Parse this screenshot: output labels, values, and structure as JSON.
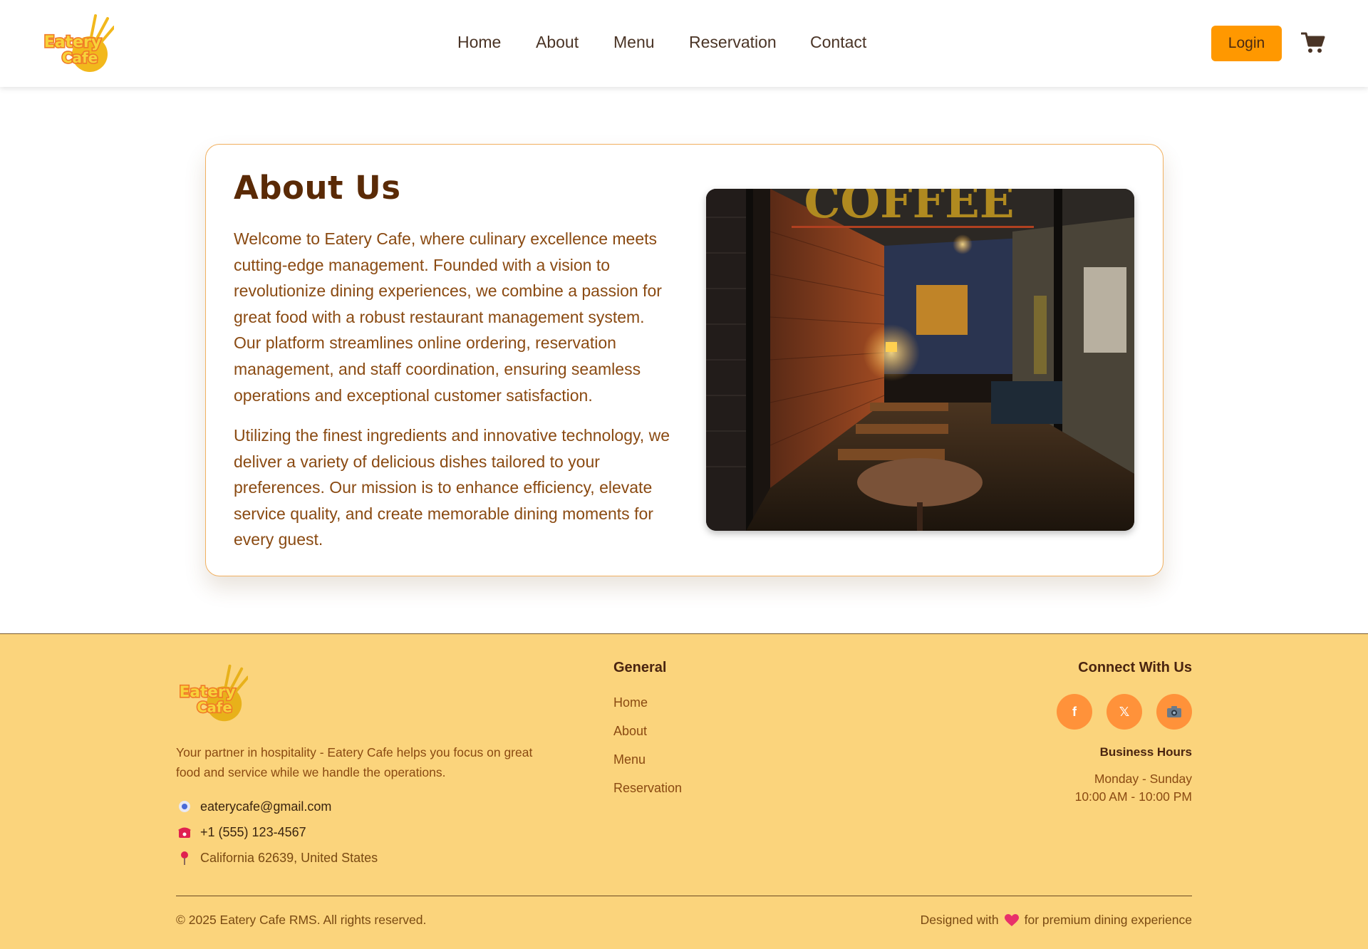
{
  "brand": {
    "logo_line1": "Eatery",
    "logo_line2": "Cafe"
  },
  "nav": {
    "items": [
      {
        "label": "Home"
      },
      {
        "label": "About"
      },
      {
        "label": "Menu"
      },
      {
        "label": "Reservation"
      },
      {
        "label": "Contact"
      }
    ],
    "login_label": "Login",
    "cart_icon": "cart-icon"
  },
  "about": {
    "title": "About Us",
    "paragraphs": [
      "Welcome to Eatery Cafe, where culinary excellence meets cutting-edge management. Founded with a vision to revolutionize dining experiences, we combine a passion for great food with a robust restaurant management system. Our platform streamlines online ordering, reservation management, and staff coordination, ensuring seamless operations and exceptional customer satisfaction.",
      "Utilizing the finest ingredients and innovative technology, we deliver a variety of delicious dishes tailored to your preferences. Our mission is to enhance efficiency, elevate service quality, and create memorable dining moments for every guest."
    ],
    "photo_sign_text": "COFFEE"
  },
  "footer": {
    "description": "Your partner in hospitality - Eatery Cafe helps you focus on great food and service while we handle the operations.",
    "contacts": [
      {
        "icon": "email-icon",
        "text": "eaterycafe@gmail.com"
      },
      {
        "icon": "phone-icon",
        "text": "+1 (555) 123-4567"
      },
      {
        "icon": "location-pin-icon",
        "text": "California 62639, United States"
      }
    ],
    "general_title": "General",
    "general_links": [
      {
        "label": "Home"
      },
      {
        "label": "About"
      },
      {
        "label": "Menu"
      },
      {
        "label": "Reservation"
      }
    ],
    "connect_title": "Connect With Us",
    "social": [
      {
        "icon": "facebook-icon",
        "glyph": "f"
      },
      {
        "icon": "x-icon",
        "glyph": "𝕏"
      },
      {
        "icon": "camera-icon",
        "glyph": ""
      }
    ],
    "hours_title": "Business Hours",
    "hours_days": "Monday - Sunday",
    "hours_time": "10:00 AM - 10:00 PM",
    "copyright": "© 2025 Eatery Cafe RMS. All rights reserved.",
    "designed_prefix": "Designed with",
    "designed_suffix": "for premium dining experience"
  },
  "colors": {
    "accent": "#ff9800",
    "footer_bg": "#fbd47c",
    "title_brown": "#5a2a06",
    "text_brown": "#8a4a12",
    "social_bg": "#ff923a"
  }
}
